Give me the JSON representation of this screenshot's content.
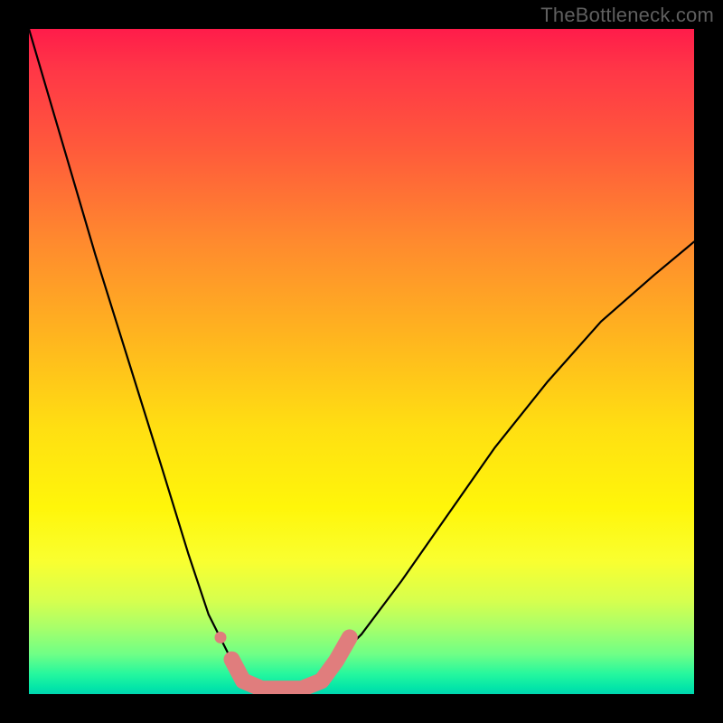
{
  "watermark": "TheBottleneck.com",
  "chart_data": {
    "type": "line",
    "title": "",
    "xlabel": "",
    "ylabel": "",
    "xlim": [
      0,
      1
    ],
    "ylim": [
      0,
      1
    ],
    "background_gradient": {
      "direction": "vertical",
      "top": "red",
      "bottom": "green",
      "via": [
        "orange",
        "yellow"
      ]
    },
    "series": [
      {
        "name": "bottleneck-curve",
        "color": "#000000",
        "x": [
          0.0,
          0.05,
          0.1,
          0.15,
          0.2,
          0.24,
          0.27,
          0.3,
          0.32,
          0.34,
          0.36,
          0.38,
          0.4,
          0.42,
          0.45,
          0.5,
          0.56,
          0.63,
          0.7,
          0.78,
          0.86,
          0.94,
          1.0
        ],
        "y": [
          1.0,
          0.83,
          0.66,
          0.5,
          0.34,
          0.21,
          0.12,
          0.06,
          0.03,
          0.015,
          0.01,
          0.01,
          0.012,
          0.02,
          0.04,
          0.09,
          0.17,
          0.27,
          0.37,
          0.47,
          0.56,
          0.63,
          0.68
        ]
      }
    ],
    "markers": [
      {
        "name": "left-small-dot",
        "x": 0.288,
        "y": 0.085
      },
      {
        "name": "left-pill-top",
        "x": 0.305,
        "y": 0.052
      },
      {
        "name": "left-pill-bot",
        "x": 0.322,
        "y": 0.02
      },
      {
        "name": "bottom-bar-l",
        "x": 0.35,
        "y": 0.008
      },
      {
        "name": "bottom-bar-r",
        "x": 0.41,
        "y": 0.008
      },
      {
        "name": "right-pill-bot",
        "x": 0.44,
        "y": 0.02
      },
      {
        "name": "right-pill-top",
        "x": 0.462,
        "y": 0.05
      },
      {
        "name": "right-pill-hi",
        "x": 0.482,
        "y": 0.085
      }
    ],
    "marker_color": "#e07d7d"
  }
}
